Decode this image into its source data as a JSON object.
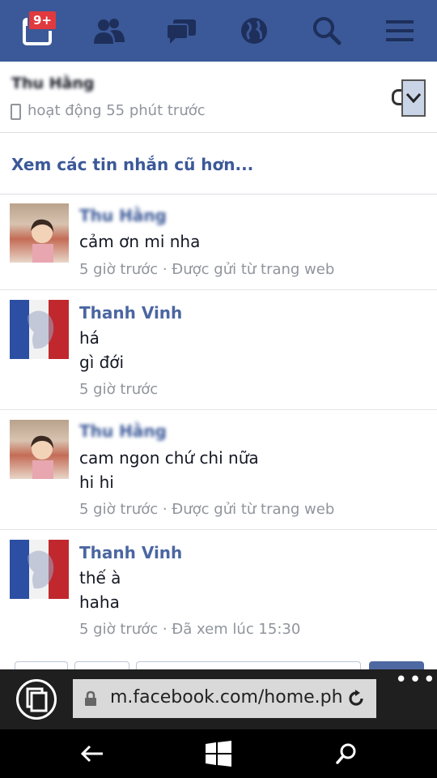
{
  "nav": {
    "notification_badge": "9+",
    "icons": [
      "notifications-icon",
      "friends-icon",
      "messages-icon",
      "globe-icon",
      "search-icon",
      "menu-icon"
    ]
  },
  "conversation": {
    "name": "Thu Hằng",
    "status": "hoạt động 55 phút trước"
  },
  "older_link": "Xem các tin nhắn cũ hơn...",
  "messages": [
    {
      "sender": "Thu Hằng",
      "lines": [
        "cảm ơn mi nha"
      ],
      "meta": "5 giờ trước · Được gửi từ trang web"
    },
    {
      "sender": "Thanh Vinh",
      "lines": [
        "há",
        "gì đới"
      ],
      "meta": "5 giờ trước"
    },
    {
      "sender": "Thu Hằng",
      "lines": [
        "cam ngon chứ chi nữa",
        "hi hi"
      ],
      "meta": "5 giờ trước · Được gửi từ trang web"
    },
    {
      "sender": "Thanh Vinh",
      "lines": [
        "thế à",
        "haha"
      ],
      "meta": "5 giờ trước · Đã xem lúc 15:30"
    }
  ],
  "browser": {
    "url": "m.facebook.com/home.php",
    "more": "•••"
  },
  "colors": {
    "brand": "#3b5998",
    "link": "#3b5998",
    "meta": "#90949c",
    "badge": "#e0393e"
  }
}
